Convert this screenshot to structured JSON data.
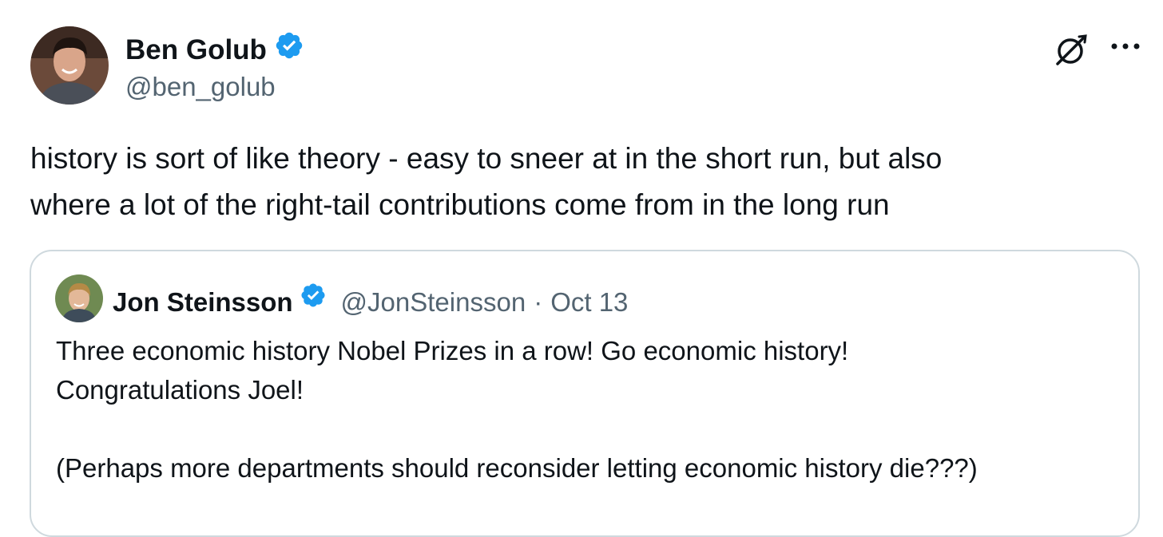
{
  "tweet": {
    "author": {
      "name": "Ben Golub",
      "handle": "@ben_golub",
      "avatar_icon": "person-avatar-icon",
      "verified": true
    },
    "text": "history is sort of like theory - easy to sneer at in the short run, but also\nwhere a lot of the right-tail contributions come from in the long run",
    "actions": {
      "logo_icon": "grok-logo-icon",
      "more_icon": "more-options-icon"
    }
  },
  "quoted_tweet": {
    "author": {
      "name": "Jon Steinsson",
      "handle": "@JonSteinsson",
      "avatar_icon": "person-avatar-icon",
      "verified": true
    },
    "separator": "·",
    "date": "Oct 13",
    "text": "Three economic history Nobel Prizes in a row! Go economic history!\nCongratulations Joel!\n\n(Perhaps more departments should reconsider letting economic history die???)"
  },
  "colors": {
    "verified_blue": "#1d9bf0",
    "secondary_text": "#536471",
    "border": "#cfd9de",
    "primary_text": "#0f1419"
  }
}
